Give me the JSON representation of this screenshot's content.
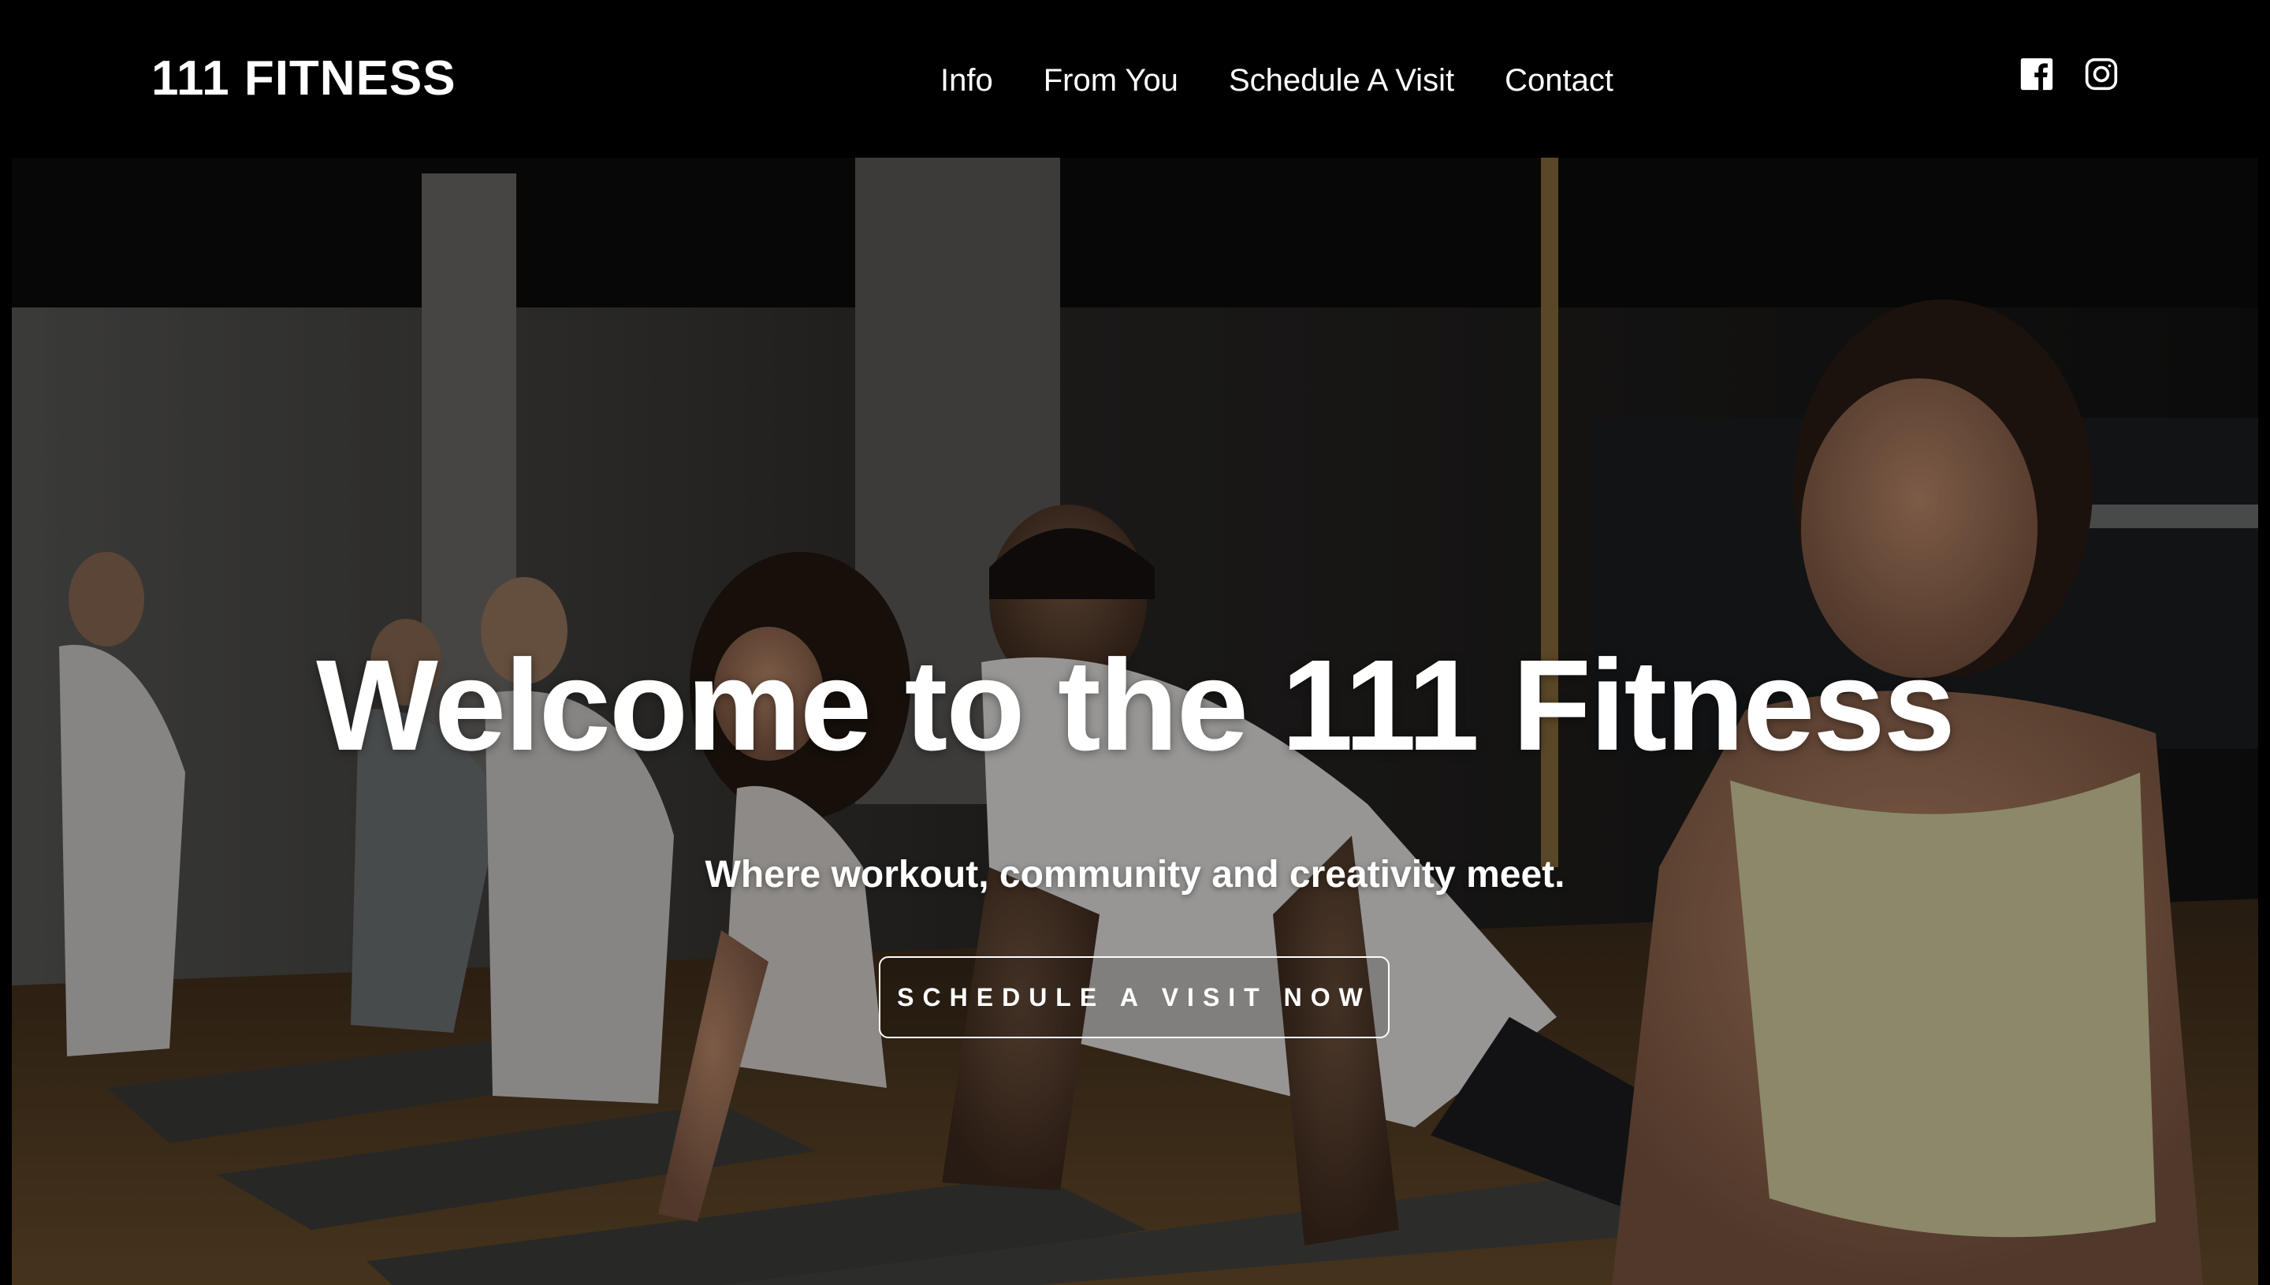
{
  "header": {
    "logo": "111 FITNESS",
    "nav": [
      {
        "label": "Info"
      },
      {
        "label": "From You"
      },
      {
        "label": "Schedule A Visit"
      },
      {
        "label": "Contact"
      }
    ],
    "social": [
      {
        "icon": "facebook-icon"
      },
      {
        "icon": "instagram-icon"
      }
    ]
  },
  "hero": {
    "title": "Welcome to the 111 Fitness",
    "subtitle": "Where workout, community and creativity meet.",
    "cta_label": "SCHEDULE A VISIT NOW",
    "background": "photo of a group yoga class in cobra pose on mats"
  },
  "colors": {
    "header_bg": "#000000",
    "text": "#ffffff",
    "accent_button_border": "#ffffff"
  }
}
